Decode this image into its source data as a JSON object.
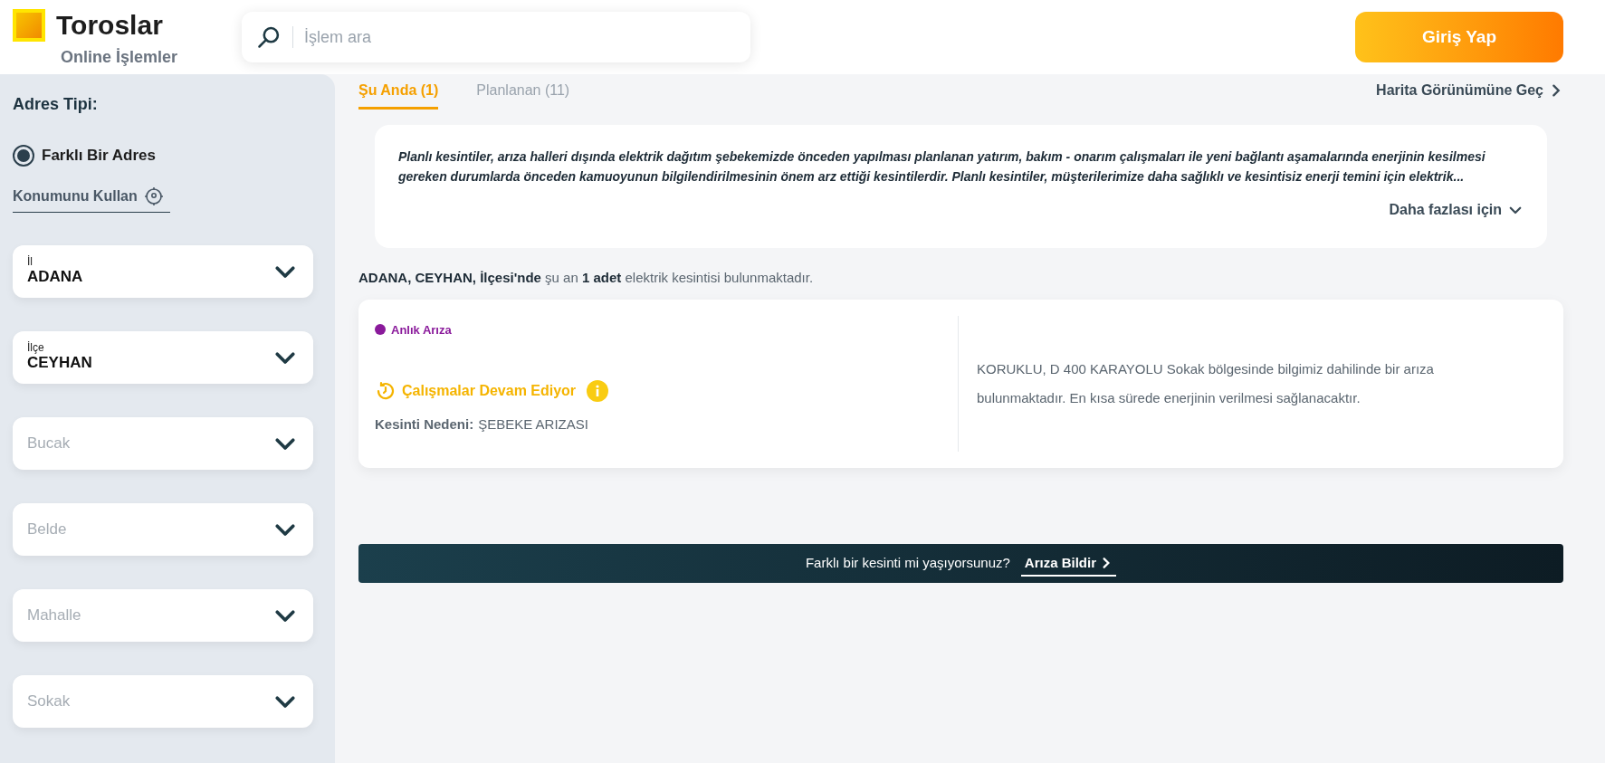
{
  "header": {
    "logo": {
      "title": "Toroslar",
      "subtitle": "Online İşlemler"
    },
    "search": {
      "placeholder": "İşlem ara"
    },
    "login_button": "Giriş Yap"
  },
  "sidebar": {
    "title": "Adres Tipi:",
    "address_type": {
      "label": "Farklı Bir Adres",
      "selected": true
    },
    "location_link": "Konumunu Kullan",
    "selects": [
      {
        "label": "İl",
        "value": "ADANA"
      },
      {
        "label": "İlçe",
        "value": "CEYHAN"
      },
      {
        "placeholder": "Bucak"
      },
      {
        "placeholder": "Belde"
      },
      {
        "placeholder": "Mahalle"
      },
      {
        "placeholder": "Sokak"
      }
    ]
  },
  "tabs": [
    {
      "label": "Şu Anda (1)",
      "selected": true
    },
    {
      "label": "Planlanan (11)",
      "selected": false
    }
  ],
  "map_link": "Harita Görünümüne Geç",
  "info": {
    "text": "Planlı kesintiler, arıza halleri dışında elektrik dağıtım şebekemizde önceden yapılması planlanan yatırım, bakım - onarım çalışmaları ile yeni bağlantı aşamalarında enerjinin kesilmesi gereken durumlarda önceden kamuoyunun bilgilendirilmesinin önem arz ettiği kesintilerdir. Planlı kesintiler, müşterilerimize daha sağlıklı ve kesintisiz enerji temini için elektrik...",
    "more": "Daha fazlası için"
  },
  "summary": "**ADANA, CEYHAN, İlçesi'nde** şu an **1 adet** elektrik kesintisi bulunmaktadır.",
  "outages": [
    {
      "type": {
        "label": "Anlık Arıza",
        "color": "#8a1a9b"
      },
      "status": "Çalışmalar Devam Ediyor",
      "reason_label": "Kesinti Nedeni:",
      "reason": "ŞEBEKE ARIZASI",
      "description": "KORUKLU, D 400 KARAYOLU Sokak bölgesinde bilgimiz dahilinde bir arıza bulunmaktadır. En kısa sürede enerjinin verilmesi sağlanacaktır."
    }
  ],
  "report_bar": {
    "text": "Farklı bir kesinti mi yaşıyorsunuz?",
    "link": "Arıza Bildir"
  }
}
